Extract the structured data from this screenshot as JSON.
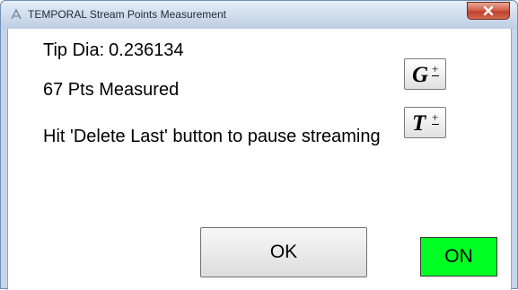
{
  "window": {
    "title": "TEMPORAL Stream Points Measurement"
  },
  "content": {
    "tip_dia_label": "Tip Dia:",
    "tip_dia_value": "0.236134",
    "points_measured": "67 Pts Measured",
    "instruction": "Hit 'Delete Last' button to pause streaming"
  },
  "buttons": {
    "g_symbol": "G",
    "t_symbol": "T",
    "plus": "+",
    "ok_label": "OK",
    "on_label": "ON"
  },
  "colors": {
    "on_button": "#00ff22",
    "close_button": "#c8553d"
  },
  "icons": {
    "title": "app-icon",
    "close": "close-icon"
  }
}
